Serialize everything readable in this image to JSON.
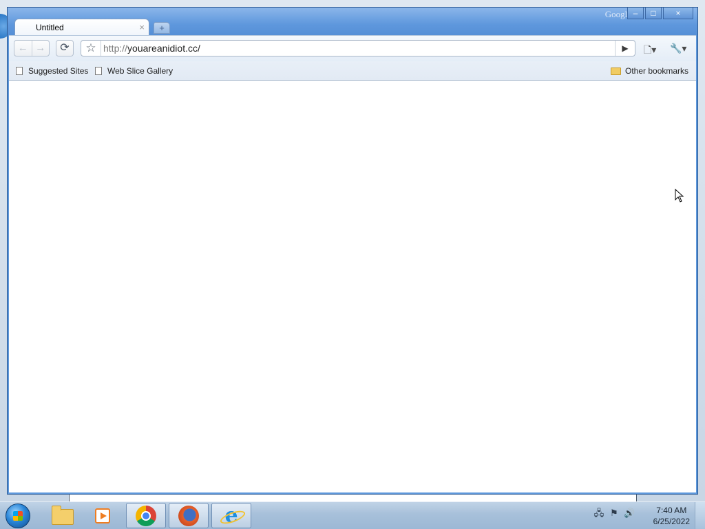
{
  "browser": {
    "brand": "Google",
    "tab": {
      "title": "Untitled",
      "close_glyph": "×"
    },
    "new_tab_glyph": "+",
    "toolbar": {
      "back_icon": "back-arrow-icon",
      "forward_icon": "forward-arrow-icon",
      "reload_icon": "reload-icon",
      "url_scheme": "http://",
      "url_host": "youareanidiot.cc/",
      "go_icon": "play-icon",
      "page_menu_icon": "page-menu-icon",
      "wrench_menu_icon": "wrench-icon"
    },
    "bookmarks": [
      {
        "label": "Suggested Sites",
        "icon": "page-icon"
      },
      {
        "label": "Web Slice Gallery",
        "icon": "page-icon"
      }
    ],
    "other_bookmarks": {
      "label": "Other bookmarks",
      "icon": "folder-icon"
    },
    "window_controls": {
      "minimize": "–",
      "maximize": "□",
      "close": "×"
    }
  },
  "taskbar": {
    "pinned": [
      {
        "name": "windows-explorer",
        "icon": "folder-icon"
      },
      {
        "name": "windows-media-player",
        "icon": "media-player-icon"
      },
      {
        "name": "google-chrome",
        "icon": "chrome-icon",
        "active": true
      },
      {
        "name": "firefox",
        "icon": "firefox-icon",
        "active": true
      },
      {
        "name": "internet-explorer",
        "icon": "ie-icon",
        "active": true
      }
    ],
    "clock": {
      "time": "7:40 AM",
      "date": "6/25/2022"
    }
  },
  "colors": {
    "title_bar": "#5f98dd",
    "taskbar": "#a7c0da",
    "content": "#ffffff"
  }
}
